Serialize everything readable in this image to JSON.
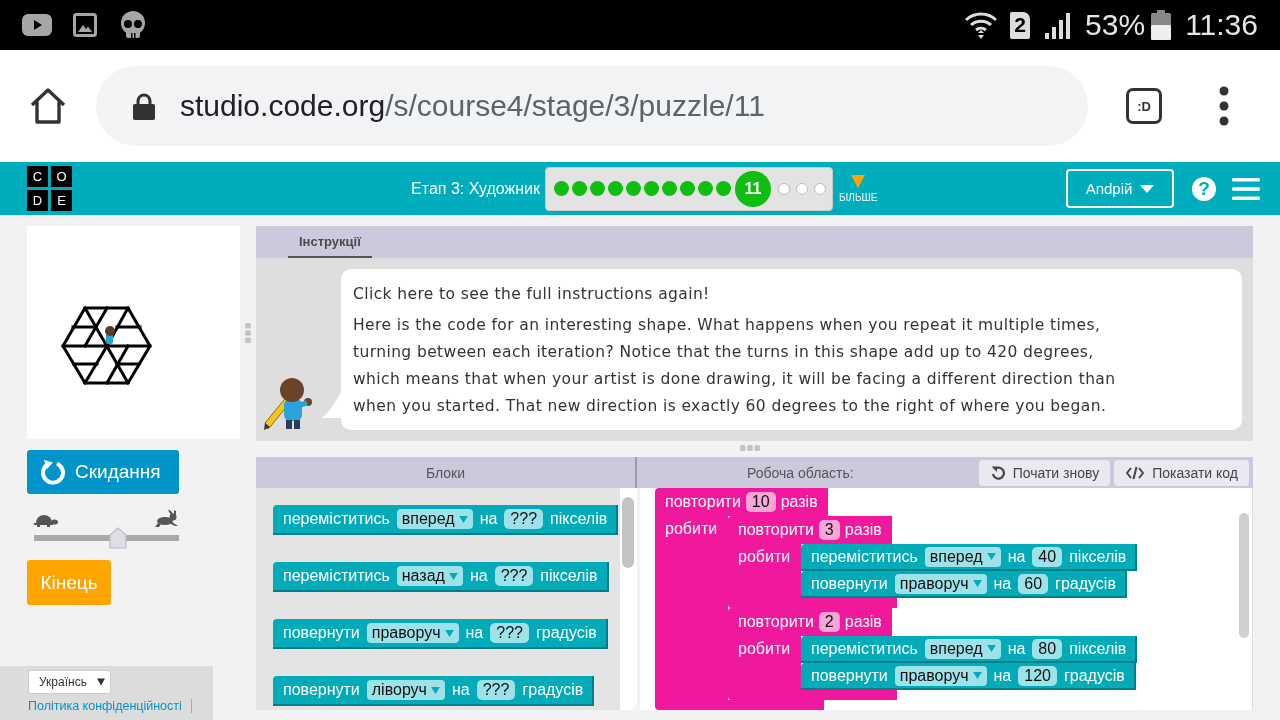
{
  "status_bar": {
    "sim_slot": "2",
    "battery": "53%",
    "time": "11:36"
  },
  "browser": {
    "url_host": "studio.code.org",
    "url_path": "/s/course4/stage/3/puzzle/11",
    "tab_switcher": ":D"
  },
  "header": {
    "logo": [
      "C",
      "O",
      "D",
      "E"
    ],
    "stage_title": "Етап 3: Художник",
    "levels": [
      {
        "completed": true,
        "selected": false
      },
      {
        "completed": true,
        "selected": false
      },
      {
        "completed": true,
        "selected": false
      },
      {
        "completed": true,
        "selected": false
      },
      {
        "completed": true,
        "selected": false
      },
      {
        "completed": true,
        "selected": false
      },
      {
        "completed": true,
        "selected": false
      },
      {
        "completed": true,
        "selected": false
      },
      {
        "completed": true,
        "selected": false
      },
      {
        "completed": true,
        "selected": false
      },
      {
        "label": "11",
        "completed": true,
        "selected": true
      },
      {
        "completed": false,
        "selected": false
      },
      {
        "completed": false,
        "selected": false
      },
      {
        "completed": false,
        "selected": false
      }
    ],
    "more_label": "БІЛЬШЕ",
    "user": "Andрій",
    "help": "?"
  },
  "stage": {
    "reset_label": "Скидання",
    "speed": {
      "level": 0.58
    },
    "finish_label": "Кінець"
  },
  "footer": {
    "language": "Українсь",
    "privacy_link": "Політика конфіденційності"
  },
  "instructions": {
    "tabs": [
      {
        "label": "Інструкції",
        "selected": true
      }
    ],
    "prompt": "Click here to see the full instructions again!",
    "text": "Here is the code for an interesting shape. What happens when you repeat it multiple times, turning between each iteration? Notice that the turns in this shape add up to 420 degrees, which means that when your artist is done drawing, it will be facing a different direction than when you started. That new direction is exactly 60 degrees to the right of where you began."
  },
  "toolbox": {
    "title": "Блоки",
    "blocks": [
      {
        "kind": "statement",
        "label": "переміститись",
        "option": "вперед",
        "joiner": "на",
        "value": "???",
        "unit": "пікселів"
      },
      {
        "kind": "statement",
        "label": "переміститись",
        "option": "назад",
        "joiner": "на",
        "value": "???",
        "unit": "пікселів"
      },
      {
        "kind": "statement",
        "label": "повернути",
        "option": "праворуч",
        "joiner": "на",
        "value": "???",
        "unit": "градусів"
      },
      {
        "kind": "statement",
        "label": "повернути",
        "option": "ліворуч",
        "joiner": "на",
        "value": "???",
        "unit": "градусів"
      }
    ]
  },
  "workspace": {
    "title": "Робоча область:",
    "start_over_label": "Почати знову",
    "show_code_label": "Показати код",
    "blocks": [
      {
        "kind": "repeat",
        "label": "повторити",
        "value": "10",
        "unit": "разів",
        "do_label": "робити",
        "children": [
          {
            "kind": "repeat",
            "label": "повторити",
            "value": "3",
            "unit": "разів",
            "do_label": "робити",
            "children": [
              {
                "kind": "statement",
                "label": "переміститись",
                "option": "вперед",
                "joiner": "на",
                "value": "40",
                "unit": "пікселів"
              },
              {
                "kind": "statement",
                "label": "повернути",
                "option": "праворуч",
                "joiner": "на",
                "value": "60",
                "unit": "градусів"
              }
            ]
          },
          {
            "kind": "repeat",
            "label": "повторити",
            "value": "2",
            "unit": "разів",
            "do_label": "робити",
            "children": [
              {
                "kind": "statement",
                "label": "переміститись",
                "option": "вперед",
                "joiner": "на",
                "value": "80",
                "unit": "пікселів"
              },
              {
                "kind": "statement",
                "label": "повернути",
                "option": "праворуч",
                "joiner": "на",
                "value": "120",
                "unit": "градусів"
              }
            ]
          }
        ]
      }
    ]
  }
}
